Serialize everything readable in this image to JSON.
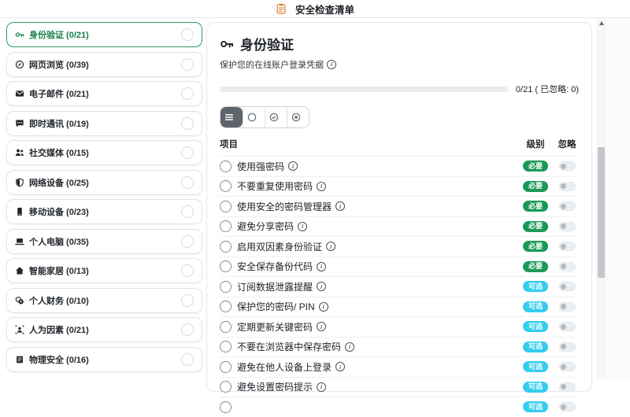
{
  "header": {
    "title": "安全检查清单",
    "icon": "clipboard-icon"
  },
  "sidebar": {
    "items": [
      {
        "label": "身份验证",
        "count": "0/21",
        "icon": "key-icon",
        "active": true
      },
      {
        "label": "网页浏览",
        "count": "0/39",
        "icon": "globe-icon",
        "active": false
      },
      {
        "label": "电子邮件",
        "count": "0/21",
        "icon": "mail-icon",
        "active": false
      },
      {
        "label": "即时通讯",
        "count": "0/19",
        "icon": "chat-icon",
        "active": false
      },
      {
        "label": "社交媒体",
        "count": "0/15",
        "icon": "users-icon",
        "active": false
      },
      {
        "label": "网络设备",
        "count": "0/25",
        "icon": "shield-icon",
        "active": false
      },
      {
        "label": "移动设备",
        "count": "0/23",
        "icon": "mobile-icon",
        "active": false
      },
      {
        "label": "个人电脑",
        "count": "0/35",
        "icon": "laptop-icon",
        "active": false
      },
      {
        "label": "智能家居",
        "count": "0/13",
        "icon": "home-icon",
        "active": false
      },
      {
        "label": "个人财务",
        "count": "0/10",
        "icon": "finance-icon",
        "active": false
      },
      {
        "label": "人为因素",
        "count": "0/21",
        "icon": "human-icon",
        "active": false
      },
      {
        "label": "物理安全",
        "count": "0/16",
        "icon": "box-icon",
        "active": false
      }
    ]
  },
  "main": {
    "title": "身份验证",
    "title_icon": "key-icon",
    "subtitle": "保护您的在线账户登录凭据",
    "progress": {
      "value": 0,
      "max": 21,
      "label": "0/21 ( 已忽略: 0)"
    },
    "filters": [
      {
        "name": "all",
        "icon": "list-icon",
        "active": true
      },
      {
        "name": "todo",
        "icon": "circle-icon",
        "active": false
      },
      {
        "name": "done",
        "icon": "check-circle-icon",
        "active": false
      },
      {
        "name": "ignored",
        "icon": "ignore-circle-icon",
        "active": false
      }
    ],
    "table_headers": [
      "项目",
      "级别",
      "忽略"
    ],
    "level_colors": {
      "必要": "#1a9956",
      "可选": "#35cdee"
    },
    "items": [
      {
        "label": "使用强密码",
        "level": "必要"
      },
      {
        "label": "不要重复使用密码",
        "level": "必要"
      },
      {
        "label": "使用安全的密码管理器",
        "level": "必要"
      },
      {
        "label": "避免分享密码",
        "level": "必要"
      },
      {
        "label": "启用双因素身份验证",
        "level": "必要"
      },
      {
        "label": "安全保存备份代码",
        "level": "必要"
      },
      {
        "label": "订阅数据泄露提醒",
        "level": "可选"
      },
      {
        "label": "保护您的密码/ PIN",
        "level": "可选"
      },
      {
        "label": "定期更新关键密码",
        "level": "可选"
      },
      {
        "label": "不要在浏览器中保存密码",
        "level": "可选"
      },
      {
        "label": "避免在他人设备上登录",
        "level": "可选"
      },
      {
        "label": "避免设置密码提示",
        "level": "可选"
      },
      {
        "label": "",
        "level": "可选",
        "partial": true
      }
    ]
  }
}
